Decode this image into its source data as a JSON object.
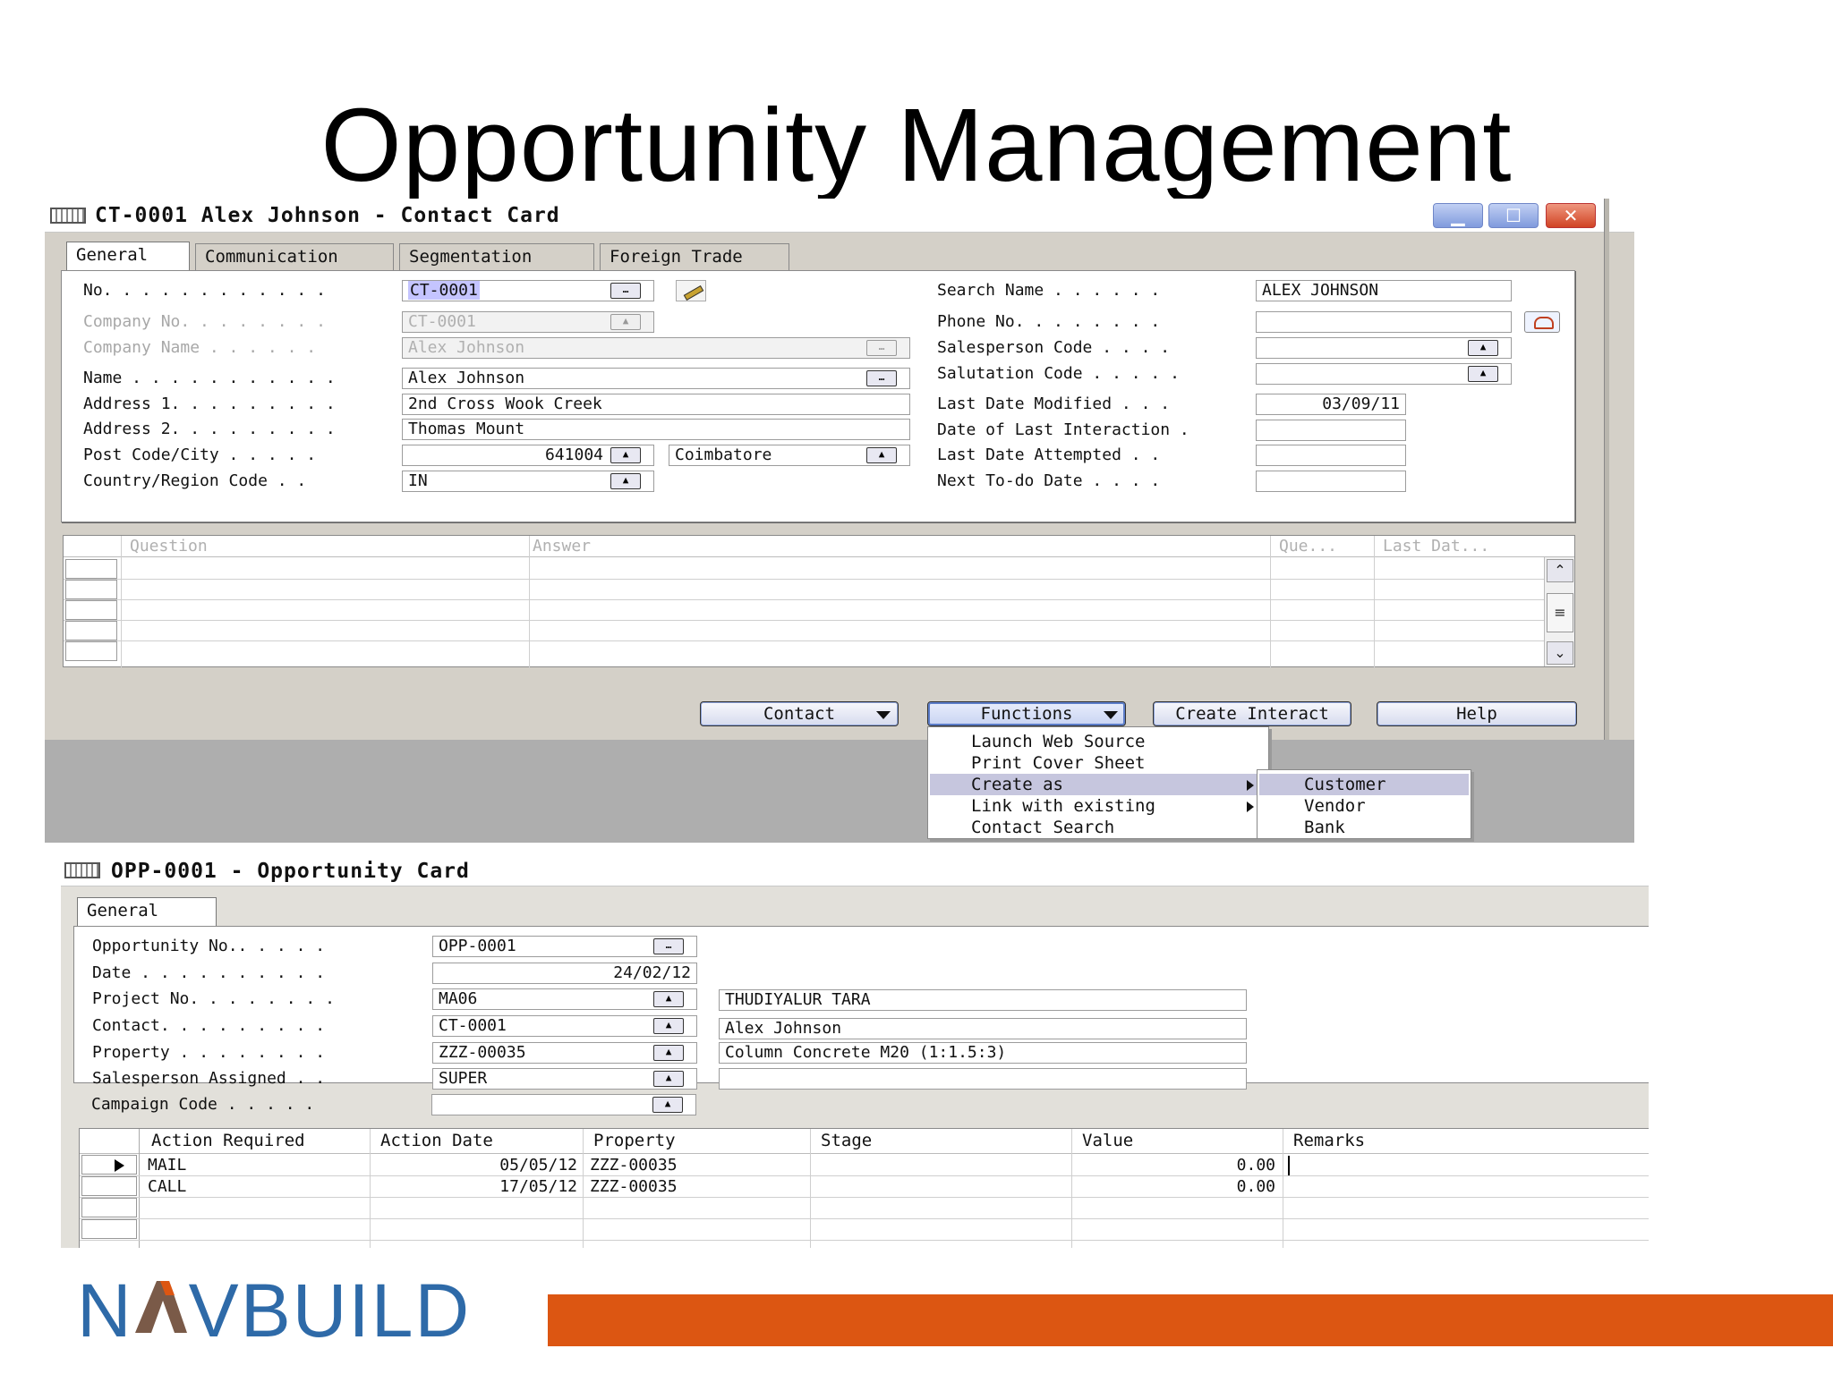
{
  "slide": {
    "title": "Opportunity Management"
  },
  "contact_card": {
    "title": "CT-0001 Alex Johnson - Contact Card",
    "window_buttons": {
      "minimize": "▁",
      "maximize": "☐",
      "close": "✕"
    },
    "tabs": [
      "General",
      "Communication",
      "Segmentation",
      "Foreign Trade"
    ],
    "left_fields": [
      {
        "label": "No. . . . . . . . . . . .",
        "value": "CT-0001"
      },
      {
        "label": "Company No. . . . . . . .",
        "value": "CT-0001"
      },
      {
        "label": "Company Name . . . . . .",
        "value": "Alex Johnson"
      },
      {
        "label": "Name . . . . . . . . . . .",
        "value": "Alex Johnson"
      },
      {
        "label": "Address 1. . . . . . . . .",
        "value": "2nd Cross Wook Creek"
      },
      {
        "label": "Address 2. . . . . . . . .",
        "value": "Thomas Mount"
      },
      {
        "label": "Post Code/City . . . . .",
        "value": "641004",
        "city": "Coimbatore"
      },
      {
        "label": "Country/Region Code . .",
        "value": "IN"
      }
    ],
    "right_fields": [
      {
        "label": "Search Name . . . . . .",
        "value": "ALEX JOHNSON"
      },
      {
        "label": "Phone No. . . . . . . .",
        "value": ""
      },
      {
        "label": "Salesperson Code . . . .",
        "value": ""
      },
      {
        "label": "Salutation Code . . . . .",
        "value": ""
      },
      {
        "label": "Last Date Modified . . .",
        "value": "03/09/11"
      },
      {
        "label": "Date of Last Interaction .",
        "value": ""
      },
      {
        "label": "Last Date Attempted . .",
        "value": ""
      },
      {
        "label": "Next To-do Date . . . .",
        "value": ""
      }
    ],
    "profile_grid": {
      "columns": [
        "Question",
        "Answer",
        "Que...",
        "Last Dat..."
      ]
    },
    "buttons": {
      "contact": "Contact",
      "functions": "Functions",
      "create_interact": "Create Interact",
      "help": "Help"
    },
    "functions_menu": [
      "Launch Web Source",
      "Print Cover Sheet",
      "Create as",
      "Link with existing",
      "Contact Search"
    ],
    "create_as_submenu": [
      "Customer",
      "Vendor",
      "Bank"
    ]
  },
  "opportunity_card": {
    "title": "OPP-0001 - Opportunity Card",
    "tab": "General",
    "fields": [
      {
        "label": "Opportunity No.. . . . .",
        "value": "OPP-0001",
        "desc": ""
      },
      {
        "label": "Date . . . . . . . . . .",
        "value": "24/02/12",
        "desc": ""
      },
      {
        "label": "Project No. . . . . . . .",
        "value": "MA06",
        "desc": "THUDIYALUR TARA"
      },
      {
        "label": "Contact. . . . . . . . .",
        "value": "CT-0001",
        "desc": "Alex Johnson"
      },
      {
        "label": "Property . . . . . . . .",
        "value": "ZZZ-00035",
        "desc": "Column Concrete M20 (1:1.5:3)"
      },
      {
        "label": "Salesperson Assigned . .",
        "value": "SUPER",
        "desc": ""
      },
      {
        "label": "Campaign Code . . . . .",
        "value": "",
        "desc": ""
      }
    ],
    "lines": {
      "columns": [
        "Action Required",
        "Action Date",
        "Property",
        "Stage",
        "Value",
        "Remarks"
      ],
      "rows": [
        {
          "action": "MAIL",
          "date": "05/05/12",
          "property": "ZZZ-00035",
          "stage": "",
          "value": "0.00",
          "remarks": ""
        },
        {
          "action": "CALL",
          "date": "17/05/12",
          "property": "ZZZ-00035",
          "stage": "",
          "value": "0.00",
          "remarks": ""
        }
      ]
    }
  },
  "footer": {
    "logo": "NAVBUILD",
    "logo_left": "N",
    "logo_right": "VBUILD",
    "bar_color": "#dc5612",
    "logo_color": "#2e6aa8"
  }
}
